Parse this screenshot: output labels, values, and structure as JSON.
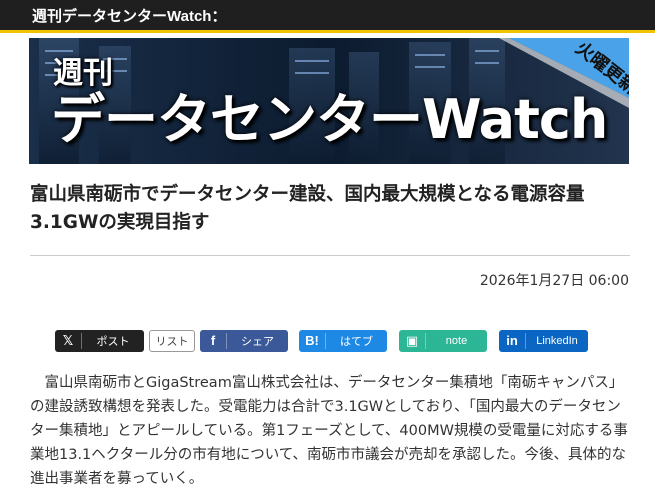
{
  "header": {
    "title": "週刊データセンターWatch："
  },
  "banner": {
    "sub": "週刊",
    "main": "データセンターWatch",
    "corner": "火曜更新"
  },
  "article": {
    "title": "富山県南砺市でデータセンター建設、国内最大規模となる電源容量3.1GWの実現目指す",
    "date": "2026年1月27日 06:00",
    "body": "富山県南砺市とGigaStream富山株式会社は、データセンター集積地「南砺キャンパス」の建設誘致構想を発表した。受電能力は合計で3.1GWとしており、「国内最大のデータセンター集積地」とアピールしている。第1フェーズとして、400MW規模の受電量に対応する事業地13.1ヘクタール分の市有地について、南砺市市議会が売却を承認した。今後、具体的な進出事業者を募っていく。"
  },
  "share": {
    "x": {
      "icon": "𝕏",
      "label": "ポスト"
    },
    "list": {
      "label": "リスト"
    },
    "facebook": {
      "icon": "f",
      "label": "シェア"
    },
    "hatena": {
      "icon": "B!",
      "label": "はてブ"
    },
    "note": {
      "icon": "▣",
      "label": "note"
    },
    "linkedin": {
      "icon": "in",
      "label": "LinkedIn"
    }
  },
  "colors": {
    "topbar": "#1f1f1f",
    "accent": "#f0c400",
    "facebook": "#3b5998",
    "hatena": "#1e88e5",
    "note": "#2cb696",
    "linkedin": "#0a66c2"
  }
}
